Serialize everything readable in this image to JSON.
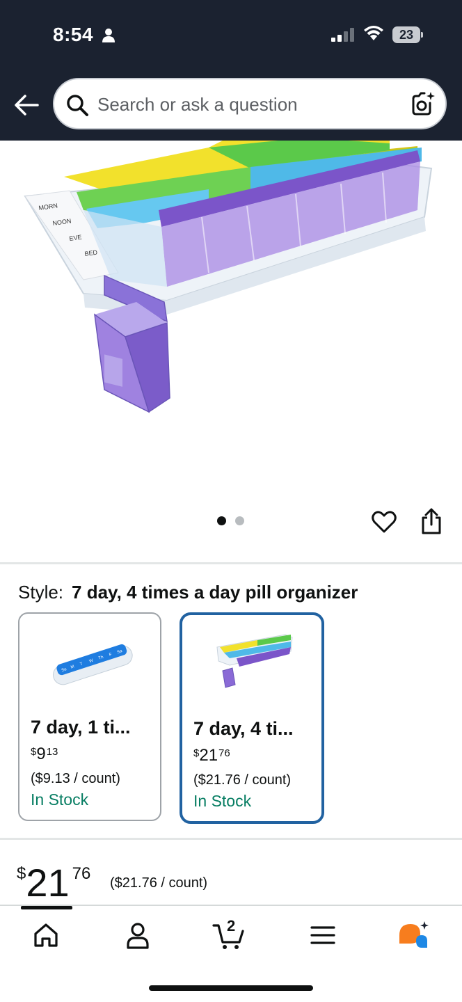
{
  "status_bar": {
    "time": "8:54",
    "battery": "23"
  },
  "header": {
    "search_placeholder": "Search or ask a question"
  },
  "gallery": {
    "image_count": 2,
    "active_index": 0
  },
  "style": {
    "label": "Style:",
    "value": "7 day, 4 times a day pill organizer",
    "options": [
      {
        "title": "7 day, 1 ti...",
        "price_symbol": "$",
        "price_whole": "9",
        "price_fraction": "13",
        "unit_price": "($9.13 / count)",
        "stock": "In Stock",
        "selected": false
      },
      {
        "title": "7 day, 4 ti...",
        "price_symbol": "$",
        "price_whole": "21",
        "price_fraction": "76",
        "unit_price": "($21.76 / count)",
        "stock": "In Stock",
        "selected": true
      }
    ]
  },
  "price": {
    "symbol": "$",
    "whole": "21",
    "fraction": "76",
    "unit_price": "($21.76 / count)"
  },
  "bottom_nav": {
    "cart_count": "2",
    "items": [
      "home-icon",
      "account-icon",
      "cart-icon",
      "menu-icon",
      "rufus-ai-icon"
    ]
  },
  "colors": {
    "header_bg": "#1b2230",
    "selected_border": "#2162a1",
    "in_stock": "#067d62",
    "ai_orange": "#f77d1e",
    "ai_blue": "#1e88e5"
  }
}
